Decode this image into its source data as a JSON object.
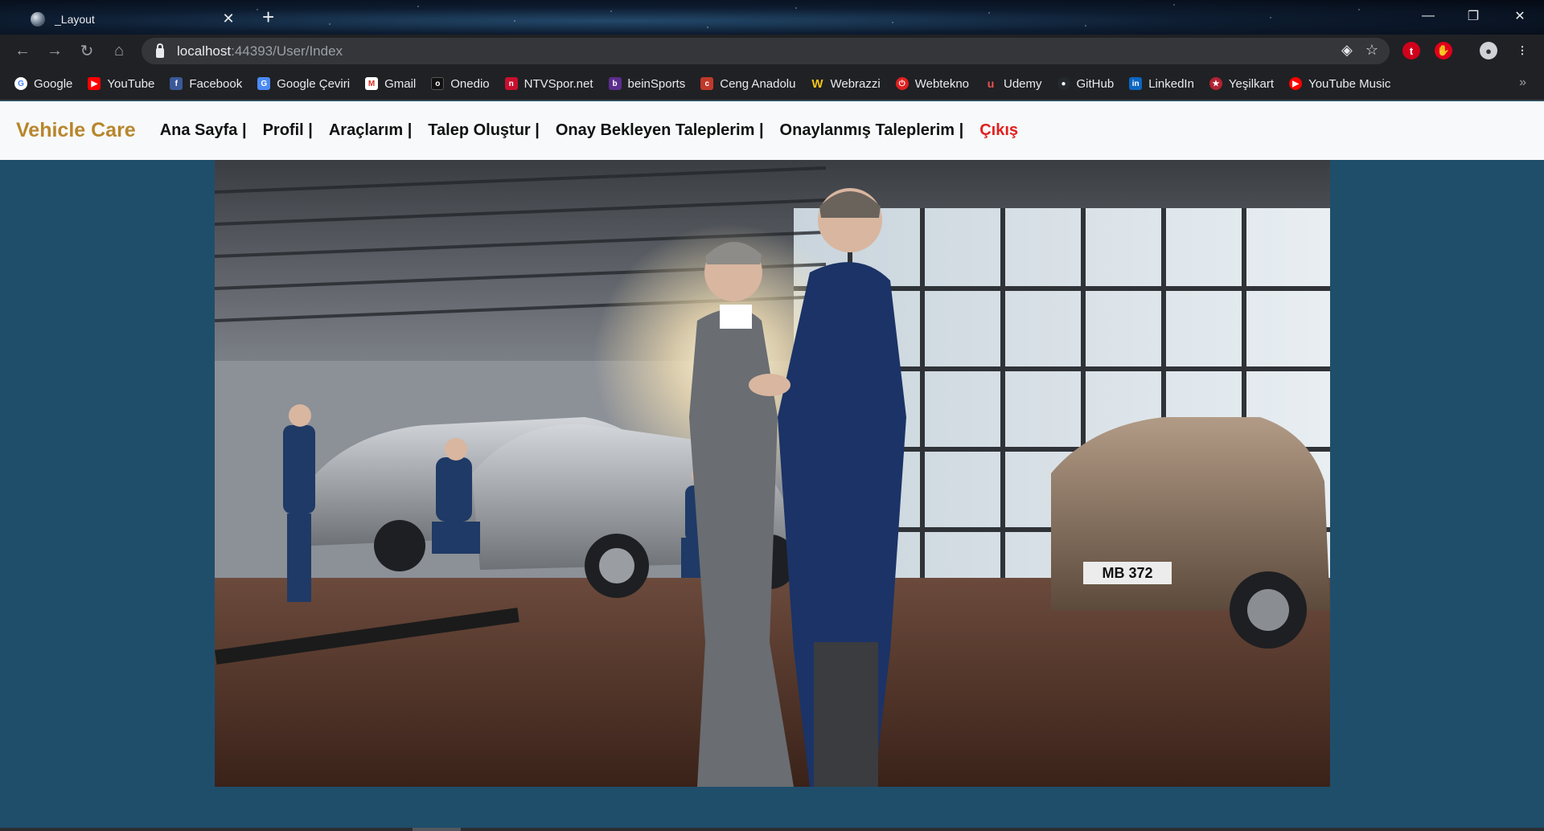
{
  "browser": {
    "tab": {
      "title": "_Layout",
      "close_icon": "close-icon"
    },
    "address": {
      "host": "localhost",
      "path": ":44393/User/Index"
    },
    "bookmarks": [
      {
        "label": "Google",
        "icon": "google-icon",
        "color": "#4285f4"
      },
      {
        "label": "YouTube",
        "icon": "youtube-icon",
        "color": "#ff0000"
      },
      {
        "label": "Facebook",
        "icon": "facebook-icon",
        "color": "#3b5998"
      },
      {
        "label": "Google Çeviri",
        "icon": "google-translate-icon",
        "color": "#4a8af4"
      },
      {
        "label": "Gmail",
        "icon": "gmail-icon",
        "color": "#d93025"
      },
      {
        "label": "Onedio",
        "icon": "onedio-icon",
        "color": "#111111"
      },
      {
        "label": "NTVSpor.net",
        "icon": "ntvspor-icon",
        "color": "#c8102e"
      },
      {
        "label": "beinSports",
        "icon": "beinsports-icon",
        "color": "#5b2d8e"
      },
      {
        "label": "Ceng Anadolu",
        "icon": "ceng-anadolu-icon",
        "color": "#c0392b"
      },
      {
        "label": "Webrazzi",
        "icon": "webrazzi-icon",
        "color": "#f5c518"
      },
      {
        "label": "Webtekno",
        "icon": "webtekno-icon",
        "color": "#e02020"
      },
      {
        "label": "Udemy",
        "icon": "udemy-icon",
        "color": "#ec5252"
      },
      {
        "label": "GitHub",
        "icon": "github-icon",
        "color": "#24292e"
      },
      {
        "label": "LinkedIn",
        "icon": "linkedin-icon",
        "color": "#0a66c2"
      },
      {
        "label": "Yeşilkart",
        "icon": "yesilkart-icon",
        "color": "#b22234"
      },
      {
        "label": "YouTube Music",
        "icon": "youtube-music-icon",
        "color": "#ff0000"
      }
    ]
  },
  "site": {
    "brand": "Vehicle Care",
    "brand_color": "#b8862c",
    "nav": [
      {
        "label": "Ana Sayfa |"
      },
      {
        "label": "Profil |"
      },
      {
        "label": "Araçlarım |"
      },
      {
        "label": "Talep Oluştur |"
      },
      {
        "label": "Onay Bekleyen Taleplerim |"
      },
      {
        "label": "Onaylanmış Taleplerim |"
      },
      {
        "label": "Çıkış",
        "color": "#e02020"
      }
    ],
    "background_color": "#1f4e6b",
    "hero": {
      "plate_text": "MB 372"
    }
  }
}
